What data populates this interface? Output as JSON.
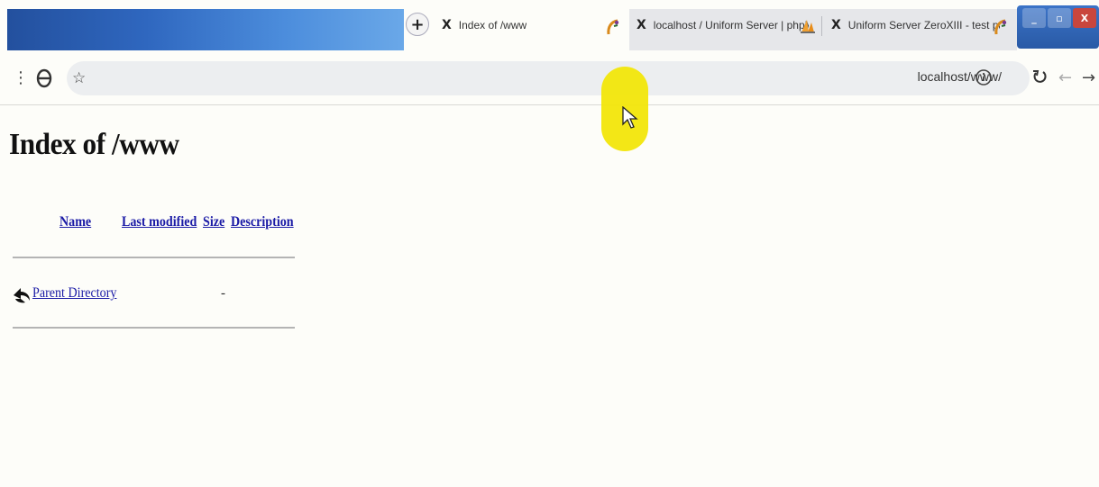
{
  "browser": {
    "tabs": [
      {
        "label": "Index of /www",
        "close": "X",
        "active": true
      },
      {
        "label": "localhost / Uniform Server | phpM",
        "close": "X",
        "active": false
      },
      {
        "label": "Uniform Server ZeroXIII - test pa",
        "close": "X",
        "active": false
      }
    ],
    "new_tab_symbol": "+",
    "url": "localhost/www/",
    "window_controls": {
      "close": "X"
    }
  },
  "page": {
    "title": "Index of /www",
    "columns": [
      "Name",
      "Last modified",
      "Size",
      "Description"
    ],
    "rows": [
      {
        "name": "Parent Directory",
        "last_modified": "",
        "size": "-",
        "description": "",
        "icon": "back-arrow-icon"
      }
    ]
  },
  "colors": {
    "link": "#1a1aa6",
    "background": "#fdfdf9",
    "cursor_highlight": "#f2e60a"
  }
}
